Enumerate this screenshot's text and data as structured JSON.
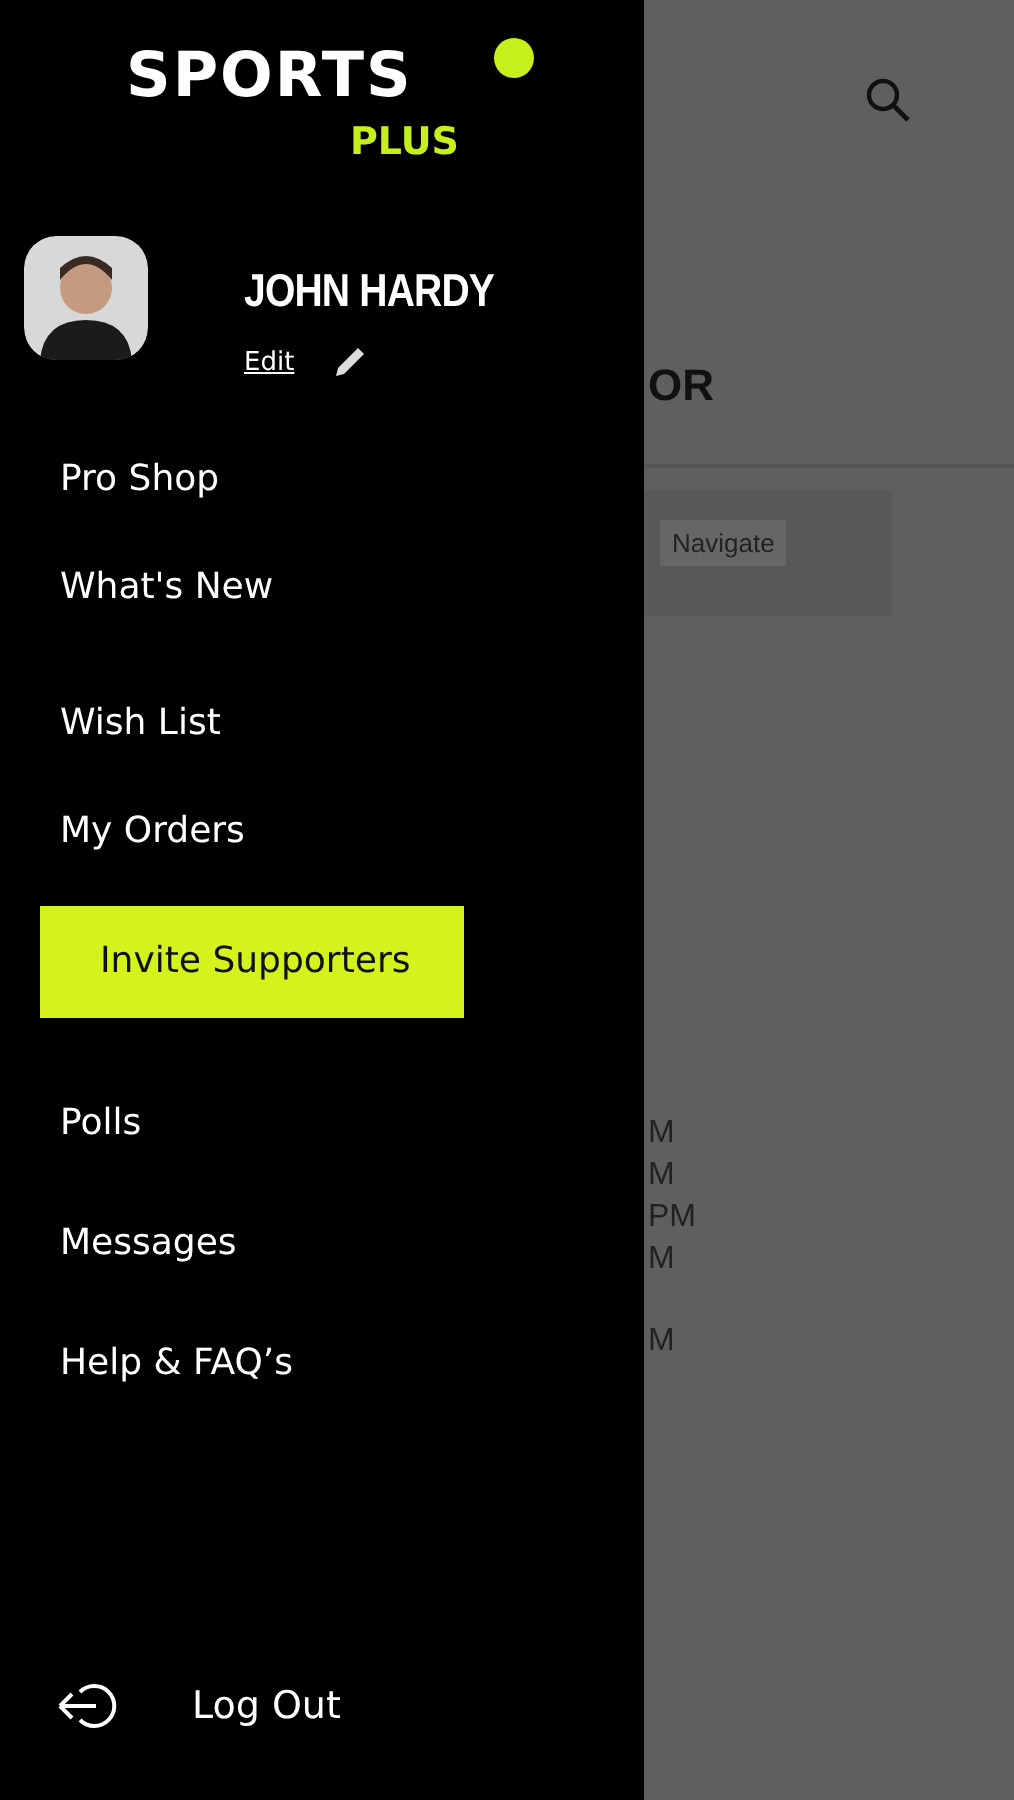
{
  "logo": {
    "word": "SPORTS",
    "sub": "PLUS"
  },
  "profile": {
    "name": "JOHN HARDY",
    "edit": "Edit"
  },
  "menu_groups": [
    {
      "items": [
        {
          "label": "Pro Shop",
          "selected": false
        },
        {
          "label": "What's New",
          "selected": false
        }
      ]
    },
    {
      "items": [
        {
          "label": "Wish List",
          "selected": false
        },
        {
          "label": "My Orders",
          "selected": false
        },
        {
          "label": "Invite Supporters",
          "selected": true
        }
      ]
    },
    {
      "items": [
        {
          "label": "Polls",
          "selected": false
        },
        {
          "label": "Messages",
          "selected": false
        },
        {
          "label": "Help & FAQ’s",
          "selected": false
        }
      ]
    }
  ],
  "logout": "Log Out",
  "background": {
    "heading": "OR",
    "button": "Navigate",
    "time_groups": [
      [
        "M",
        "M",
        "PM",
        "M"
      ],
      [
        "M"
      ]
    ]
  }
}
